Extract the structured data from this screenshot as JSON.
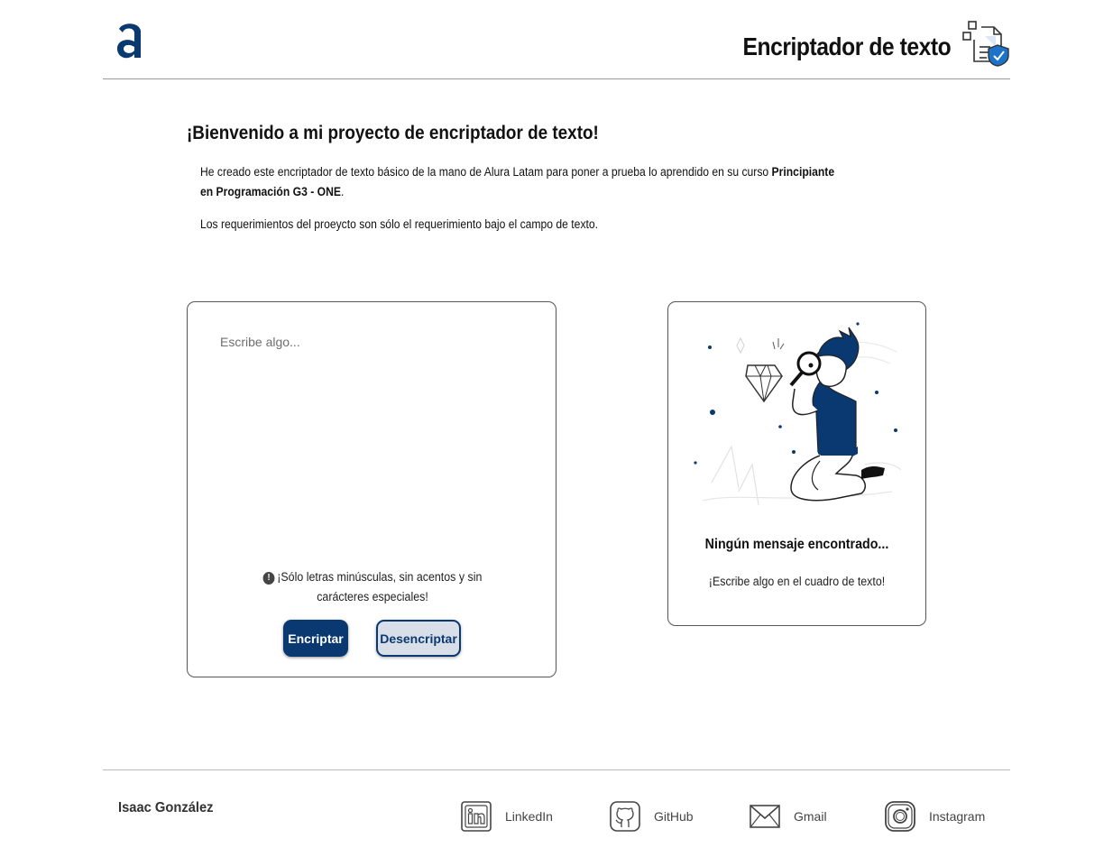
{
  "header": {
    "logo_icon": "alura-logo-icon",
    "title": "Encriptador de texto",
    "title_icon": "encrypted-document-icon"
  },
  "intro": {
    "heading": "¡Bienvenido a mi proyecto de encriptador de texto!",
    "paragraph1_text": "He creado este encriptador de texto básico de la mano de Alura Latam para poner a prueba lo aprendido en su curso ",
    "paragraph1_bold": "Principiante en Programación G3 - ONE",
    "paragraph1_end": ".",
    "paragraph2": "Los requerimientos del proeycto son sólo el requerimiento bajo el campo de texto."
  },
  "input_card": {
    "placeholder": "Escribe algo...",
    "value": "",
    "warning": "¡Sólo letras minúsculas, sin acentos y sin carácteres especiales!",
    "encrypt_label": "Encriptar",
    "decrypt_label": "Desencriptar"
  },
  "output_card": {
    "illustration": "person-with-magnifying-glass-illustration",
    "title": "Ningún mensaje encontrado...",
    "subtitle": "¡Escribe algo en el cuadro de texto!"
  },
  "footer": {
    "author": "Isaac González",
    "links": [
      {
        "label": "LinkedIn",
        "icon": "linkedin-icon"
      },
      {
        "label": "GitHub",
        "icon": "github-icon"
      },
      {
        "label": "Gmail",
        "icon": "gmail-icon"
      },
      {
        "label": "Instagram",
        "icon": "instagram-icon"
      }
    ]
  },
  "colors": {
    "primary": "#0a3871",
    "button_secondary_bg": "#d8dfe8",
    "border": "#555555"
  }
}
